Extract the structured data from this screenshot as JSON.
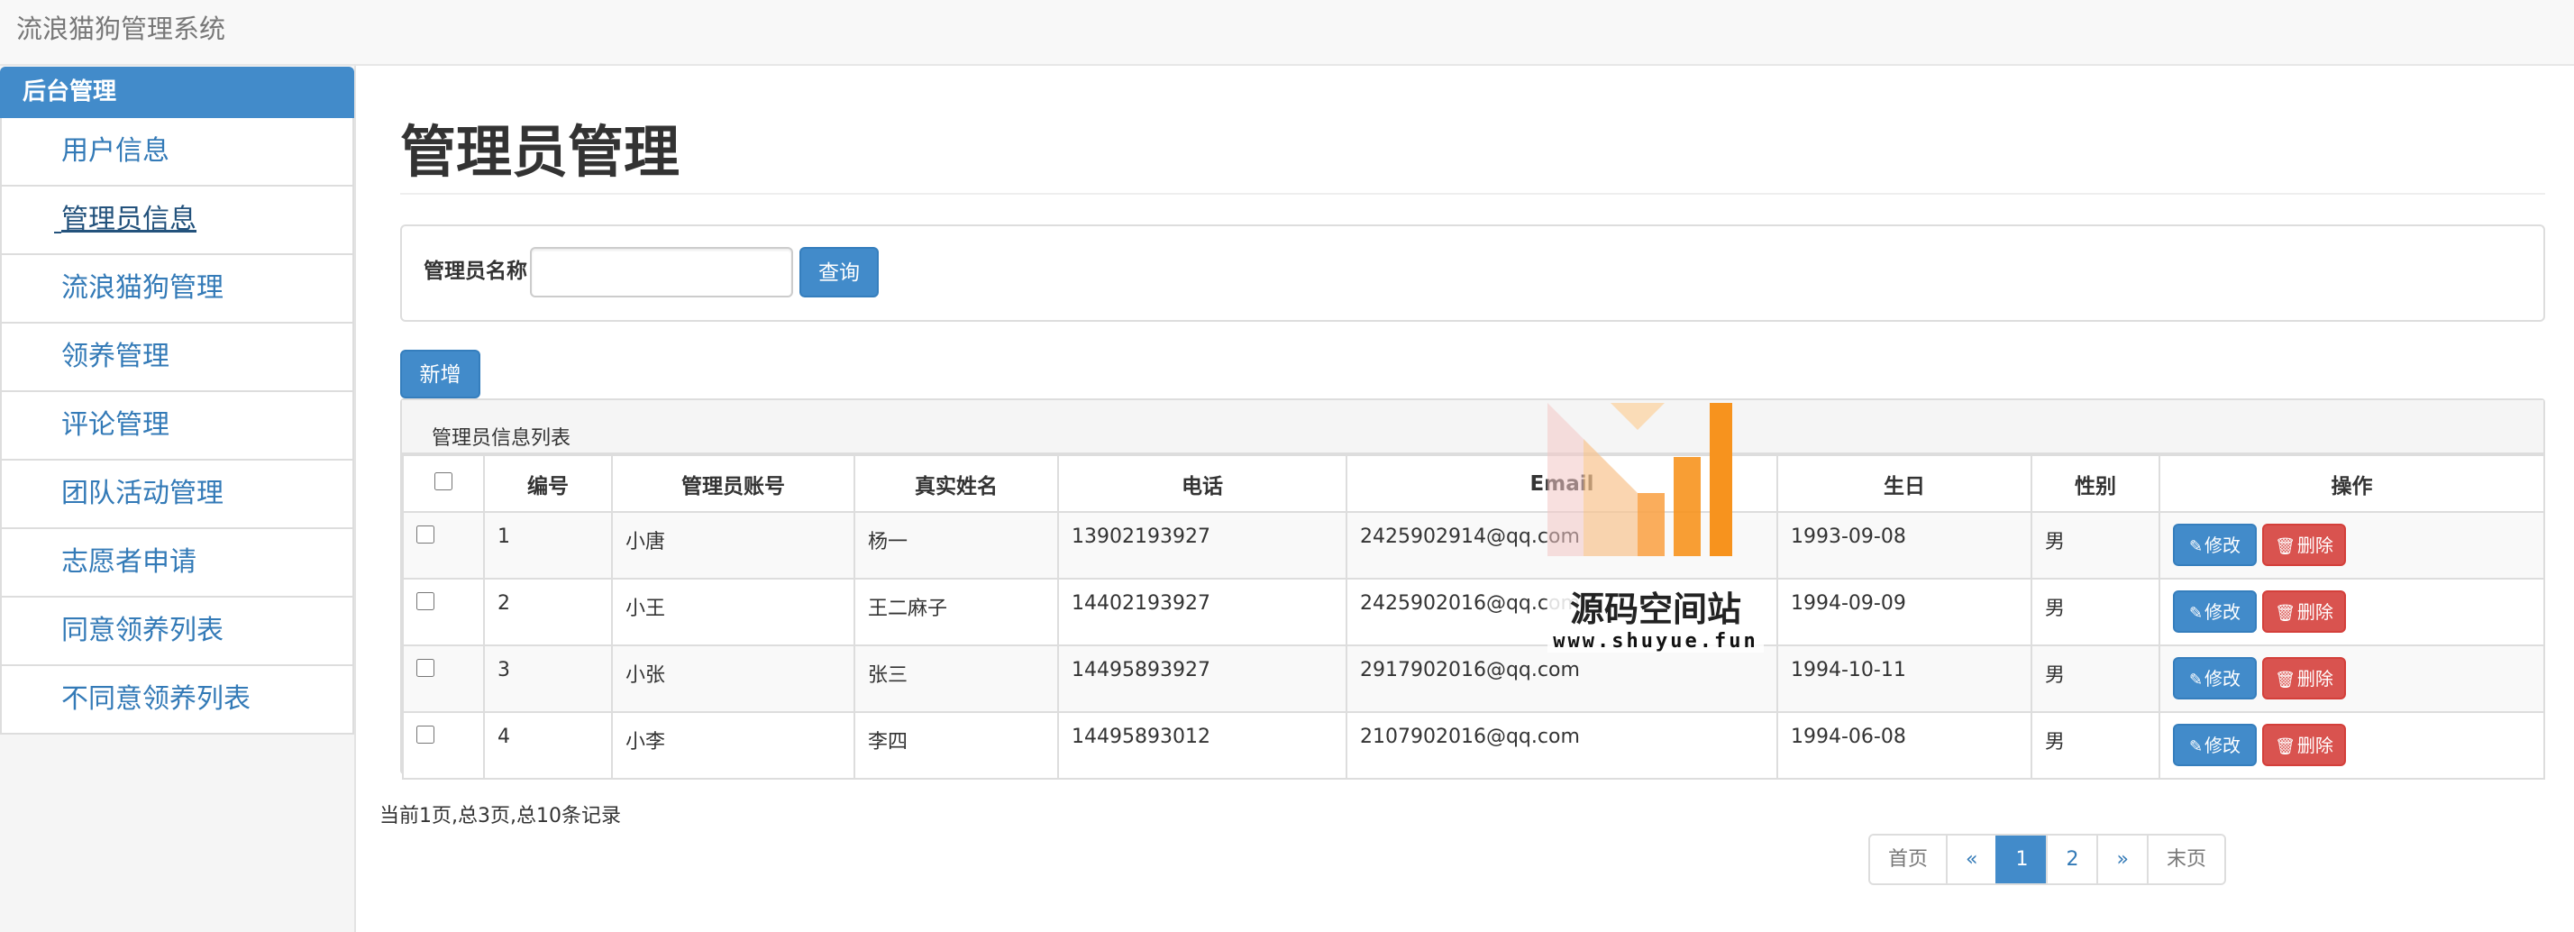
{
  "app": {
    "brand": "流浪猫狗管理系统"
  },
  "sidebar": {
    "header": "后台管理",
    "items": [
      {
        "label": "用户信息",
        "active": false
      },
      {
        "label": "管理员信息",
        "active": true
      },
      {
        "label": "流浪猫狗管理",
        "active": false
      },
      {
        "label": "领养管理",
        "active": false
      },
      {
        "label": "评论管理",
        "active": false
      },
      {
        "label": "团队活动管理",
        "active": false
      },
      {
        "label": "志愿者申请",
        "active": false
      },
      {
        "label": "同意领养列表",
        "active": false
      },
      {
        "label": "不同意领养列表",
        "active": false
      }
    ]
  },
  "main": {
    "title": "管理员管理",
    "search": {
      "label": "管理员名称",
      "value": "",
      "placeholder": "",
      "button": "查询"
    },
    "add_button": "新增",
    "table": {
      "caption": "管理员信息列表",
      "columns": [
        "编号",
        "管理员账号",
        "真实姓名",
        "电话",
        "Email",
        "生日",
        "性别",
        "操作"
      ],
      "rows": [
        {
          "id": "1",
          "account": "小唐",
          "name": "杨一",
          "phone": "13902193927",
          "email": "2425902914@qq.com",
          "birthday": "1993-09-08",
          "gender": "男"
        },
        {
          "id": "2",
          "account": "小王",
          "name": "王二麻子",
          "phone": "14402193927",
          "email": "2425902016@qq.com",
          "birthday": "1994-09-09",
          "gender": "男"
        },
        {
          "id": "3",
          "account": "小张",
          "name": "张三",
          "phone": "14495893927",
          "email": "2917902016@qq.com",
          "birthday": "1994-10-11",
          "gender": "男"
        },
        {
          "id": "4",
          "account": "小李",
          "name": "李四",
          "phone": "14495893012",
          "email": "2107902016@qq.com",
          "birthday": "1994-06-08",
          "gender": "男"
        }
      ],
      "edit_label": "修改",
      "delete_label": "删除"
    },
    "record_info": "当前1页,总3页,总10条记录",
    "pagination": {
      "first": "首页",
      "prev": "«",
      "pages": [
        "1",
        "2"
      ],
      "current": "1",
      "next": "»",
      "last": "末页"
    }
  },
  "watermark": {
    "text": "源码空间站",
    "url": "www.shuyue.fun"
  },
  "colors": {
    "primary": "#428bca",
    "danger": "#d9534f",
    "link": "#337ab7",
    "watermark_orange": "#f7931e"
  },
  "icons": {
    "edit": "pencil-icon",
    "delete": "trash-icon"
  }
}
